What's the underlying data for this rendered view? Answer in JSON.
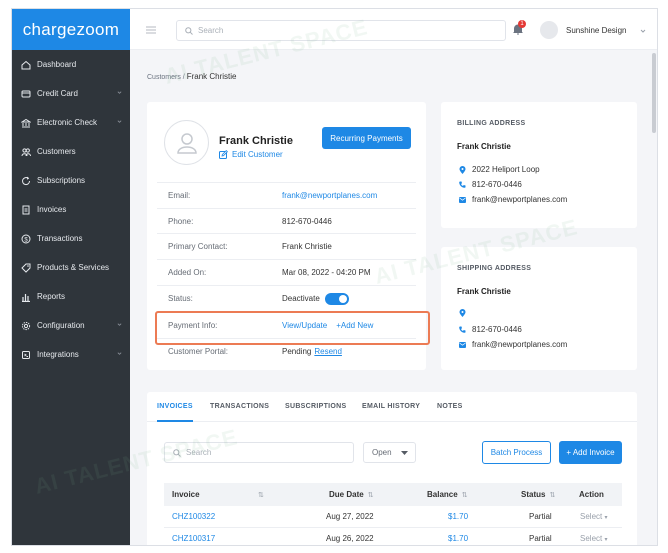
{
  "brand": {
    "logo_text": "chargezoom",
    "accent": "#1e88e5",
    "sidebar_bg": "#2f353b",
    "highlight": "#ec7b54"
  },
  "sidebar": {
    "items": [
      {
        "label": "Dashboard",
        "icon": "home-icon",
        "has_caret": false
      },
      {
        "label": "Credit Card",
        "icon": "credit-card-icon",
        "has_caret": true
      },
      {
        "label": "Electronic Check",
        "icon": "bank-icon",
        "has_caret": true
      },
      {
        "label": "Customers",
        "icon": "users-icon",
        "has_caret": false
      },
      {
        "label": "Subscriptions",
        "icon": "refresh-icon",
        "has_caret": false
      },
      {
        "label": "Invoices",
        "icon": "invoice-icon",
        "has_caret": false
      },
      {
        "label": "Transactions",
        "icon": "dollar-icon",
        "has_caret": false
      },
      {
        "label": "Products & Services",
        "icon": "tag-icon",
        "has_caret": false
      },
      {
        "label": "Reports",
        "icon": "bar-chart-icon",
        "has_caret": false
      },
      {
        "label": "Configuration",
        "icon": "gear-icon",
        "has_caret": true
      },
      {
        "label": "Integrations",
        "icon": "plug-icon",
        "has_caret": true
      }
    ]
  },
  "topbar": {
    "search_placeholder": "Search",
    "notification_count": "1",
    "user_name": "Sunshine Design"
  },
  "breadcrumb": {
    "parent": "Customers",
    "separator": " / ",
    "current": "Frank Christie"
  },
  "customer": {
    "name": "Frank Christie",
    "edit_label": "Edit Customer",
    "recurring_label": "Recurring Payments",
    "fields": {
      "email": {
        "label": "Email:",
        "value": "frank@newportplanes.com"
      },
      "phone": {
        "label": "Phone:",
        "value": "812-670-0446"
      },
      "primary_contact": {
        "label": "Primary Contact:",
        "value": "Frank Christie"
      },
      "added_on": {
        "label": "Added On:",
        "value": "Mar 08, 2022 - 04:20 PM"
      },
      "status": {
        "label": "Status:",
        "value": "Deactivate"
      },
      "payment_info": {
        "label": "Payment Info:",
        "view_update": "View/Update",
        "add_new": "+Add New"
      },
      "customer_portal": {
        "label": "Customer Portal:",
        "value": "Pending",
        "resend": "Resend"
      }
    }
  },
  "billing": {
    "title": "BILLING ADDRESS",
    "name": "Frank Christie",
    "address": "2022 Heliport Loop",
    "phone": "812-670-0446",
    "email": "frank@newportplanes.com"
  },
  "shipping": {
    "title": "SHIPPING ADDRESS",
    "name": "Frank Christie",
    "address": "",
    "phone": "812-670-0446",
    "email": "frank@newportplanes.com"
  },
  "invoices_panel": {
    "tabs": [
      "INVOICES",
      "TRANSACTIONS",
      "SUBSCRIPTIONS",
      "EMAIL HISTORY",
      "NOTES"
    ],
    "search_placeholder": "Search",
    "status_filter": "Open",
    "batch_label": "Batch Process",
    "add_label": "+ Add Invoice",
    "columns": {
      "invoice": "Invoice",
      "due": "Due Date",
      "balance": "Balance",
      "status": "Status",
      "action": "Action",
      "sort_glyph": "⇅"
    },
    "rows": [
      {
        "invoice": "CHZ100322",
        "due": "Aug 27, 2022",
        "balance": "$1.70",
        "status": "Partial",
        "action": "Select"
      },
      {
        "invoice": "CHZ100317",
        "due": "Aug 26, 2022",
        "balance": "$1.70",
        "status": "Partial",
        "action": "Select"
      }
    ]
  },
  "watermark_text": "AI TALENT SPACE"
}
